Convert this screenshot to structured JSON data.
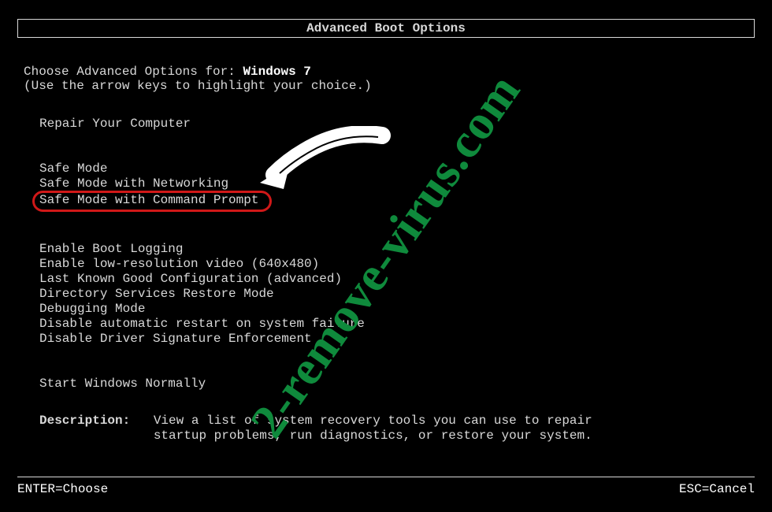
{
  "title": "Advanced Boot Options",
  "choose_prefix": "Choose Advanced Options for: ",
  "os_name": "Windows 7",
  "hint": "(Use the arrow keys to highlight your choice.)",
  "options": {
    "group1": [
      "Repair Your Computer"
    ],
    "group2": [
      "Safe Mode",
      "Safe Mode with Networking",
      "Safe Mode with Command Prompt"
    ],
    "group3": [
      "Enable Boot Logging",
      "Enable low-resolution video (640x480)",
      "Last Known Good Configuration (advanced)",
      "Directory Services Restore Mode",
      "Debugging Mode",
      "Disable automatic restart on system failure",
      "Disable Driver Signature Enforcement"
    ],
    "group4": [
      "Start Windows Normally"
    ]
  },
  "highlighted_option": "Safe Mode with Command Prompt",
  "description": {
    "label": "Description:",
    "text": "View a list of system recovery tools you can use to repair startup problems, run diagnostics, or restore your system."
  },
  "footer": {
    "enter": "ENTER=Choose",
    "esc": "ESC=Cancel"
  },
  "watermark": "2-remove-virus.com"
}
